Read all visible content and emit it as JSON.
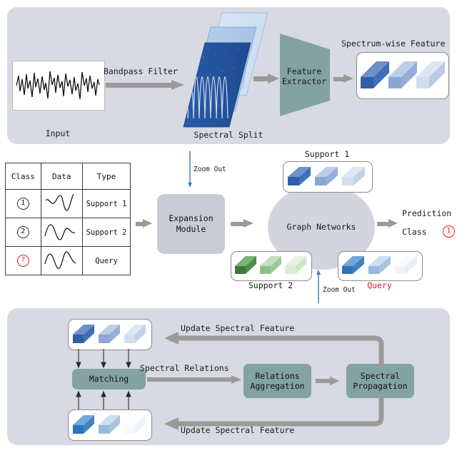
{
  "figure": {
    "title": "Spectral few-shot learning pipeline diagram",
    "panel_bg": "#d7dae2",
    "accent_teal": "#83a2a4",
    "accent_red": "#e8191b",
    "accent_blue": "#3f6fb5",
    "arrow_gray": "#9a9a9a"
  },
  "top_panel": {
    "input_label": "Input",
    "bandpass_label": "Bandpass Filter",
    "spectral_split_label": "Spectral Split",
    "feature_extractor_label": "Feature\nExtractor",
    "spectrum_feature_label": "Spectrum-wise Feature"
  },
  "middle_panel": {
    "table": {
      "headers": [
        "Class",
        "Data",
        "Type"
      ],
      "rows": [
        {
          "class": "1",
          "class_style": "circled",
          "data": "waveform-1",
          "type": "Support 1",
          "type_color": "#111111"
        },
        {
          "class": "2",
          "class_style": "circled",
          "data": "waveform-2",
          "type": "Support 2",
          "type_color": "#111111"
        },
        {
          "class": "?",
          "class_style": "circled-red",
          "data": "waveform-3",
          "type": "Query",
          "type_color": "#e8191b"
        }
      ]
    },
    "expansion_module_label": "Expansion\nModule",
    "graph_networks_label": "Graph Networks",
    "support1_label": "Support 1",
    "support2_label": "Support 2",
    "query_label": "Query",
    "zoom_out_top_label": "Zoom Out",
    "zoom_out_bottom_label": "Zoom Out",
    "prediction_line1": "Prediction",
    "prediction_line2": "Class",
    "prediction_class_value": "1"
  },
  "bottom_panel": {
    "matching_label": "Matching",
    "spectral_relations_label": "Spectral Relations",
    "relations_aggregation_label": "Relations\nAggregation",
    "spectral_propagation_label": "Spectral\nPropagation",
    "update_top_label": "Update Spectral Feature",
    "update_bottom_label": "Update Spectral Feature"
  },
  "cubes": {
    "spectrum_feature": [
      "#3f6fb5",
      "#93aed8",
      "#b9cbe6"
    ],
    "support1": [
      "#3f6fb5",
      "#93aed8",
      "#c3d2ea"
    ],
    "support2": [
      "#4f8f4c",
      "#9ec99a",
      "#cfe6cb"
    ],
    "query": [
      "#3f82c4",
      "#a8c2e2",
      "#e8eef7"
    ],
    "match_top": [
      "#3f6fb5",
      "#93aed8",
      "#c3d2ea"
    ],
    "match_bottom": [
      "#3f82c4",
      "#a8c2e2",
      "#eef3fa"
    ]
  }
}
